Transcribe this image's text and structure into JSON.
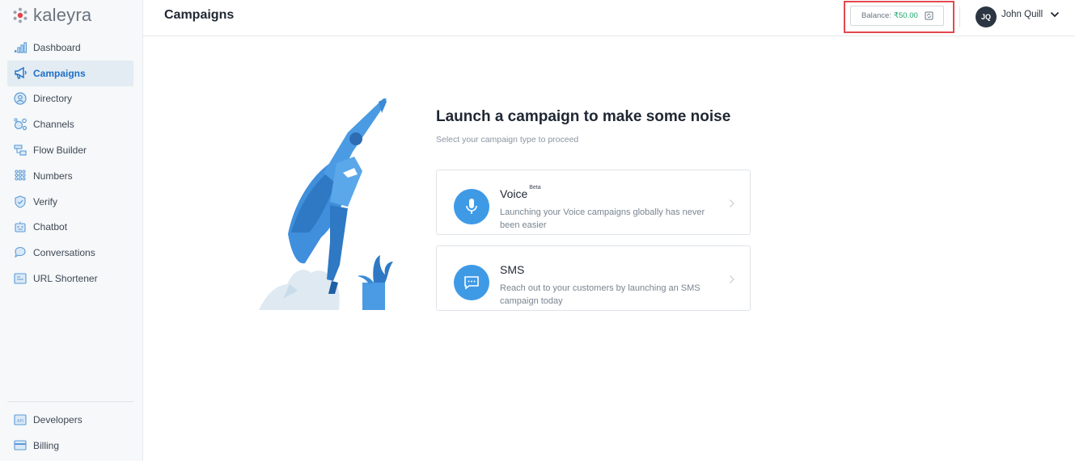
{
  "brand": {
    "name": "kaleyra"
  },
  "sidebar": {
    "items": [
      {
        "label": "Dashboard",
        "icon": "bar-chart-icon"
      },
      {
        "label": "Campaigns",
        "icon": "megaphone-icon",
        "active": true
      },
      {
        "label": "Directory",
        "icon": "contact-icon"
      },
      {
        "label": "Channels",
        "icon": "channels-icon"
      },
      {
        "label": "Flow Builder",
        "icon": "flow-icon"
      },
      {
        "label": "Numbers",
        "icon": "dialpad-icon"
      },
      {
        "label": "Verify",
        "icon": "shield-check-icon"
      },
      {
        "label": "Chatbot",
        "icon": "robot-icon"
      },
      {
        "label": "Conversations",
        "icon": "chat-bubbles-icon"
      },
      {
        "label": "URL Shortener",
        "icon": "link-icon"
      }
    ],
    "bottom_items": [
      {
        "label": "Developers",
        "icon": "api-icon"
      },
      {
        "label": "Billing",
        "icon": "credit-card-icon"
      }
    ]
  },
  "header": {
    "title": "Campaigns",
    "balance_label": "Balance:",
    "balance_value": "₹50.00",
    "user_initials": "JQ",
    "user_name": "John Quill"
  },
  "main": {
    "headline": "Launch a campaign to make some noise",
    "subline": "Select your campaign type to proceed",
    "cards": [
      {
        "title": "Voice",
        "badge": "Beta",
        "description": "Launching your Voice campaigns globally has never been easier",
        "icon": "microphone-icon"
      },
      {
        "title": "SMS",
        "badge": "",
        "description": "Reach out to your customers by launching an SMS campaign today",
        "icon": "message-icon"
      }
    ]
  },
  "colors": {
    "accent": "#1f6fc5",
    "icon_blue": "#3f9ae6",
    "balance_green": "#1aa86b",
    "highlight_red": "#e3494f"
  }
}
